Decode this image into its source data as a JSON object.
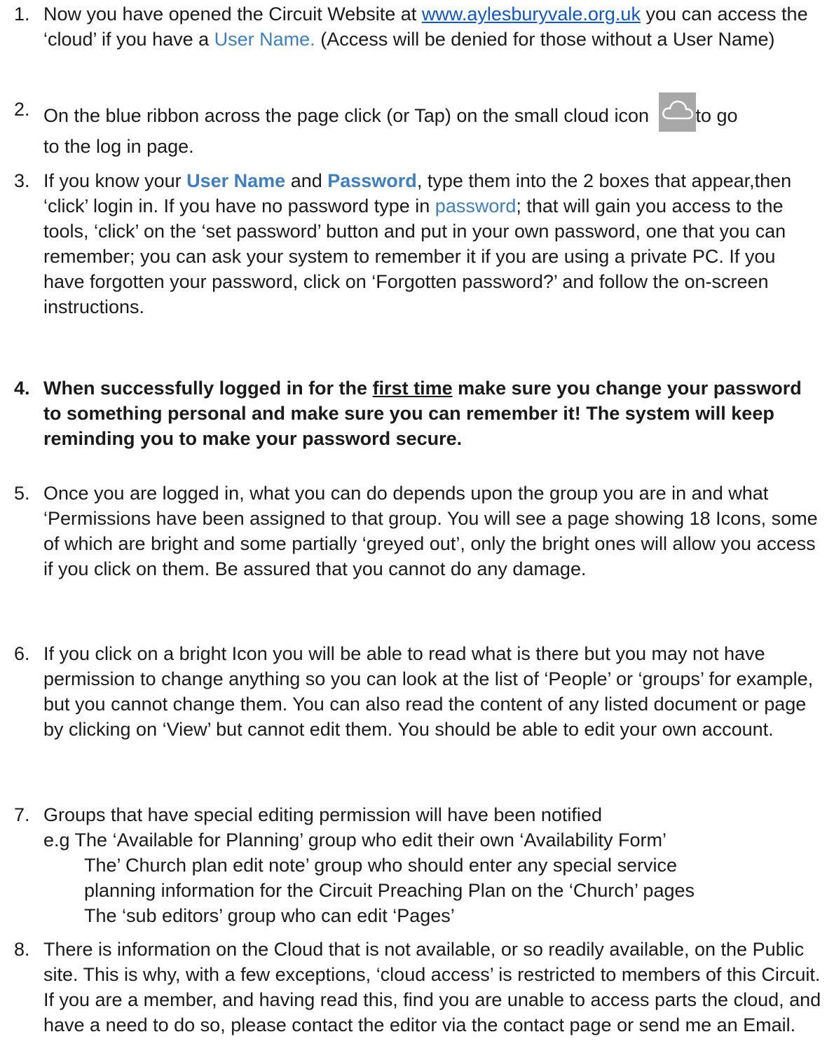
{
  "items": [
    {
      "number": "1.",
      "pre_link": "Now you have opened the Circuit Website at ",
      "link": "www.aylesburyvale.org.uk",
      "post_link": " you can access the ‘cloud’ if you have a ",
      "user_name": "User Name.",
      "tail": " (Access will be denied for those without a User Name)"
    },
    {
      "number": "2.",
      "line1": "On the blue ribbon across the page click (or Tap) on the small cloud icon",
      "line1_tail": "to go",
      "line2": "to the log in page.",
      "icon": "cloud-icon"
    },
    {
      "number": "3.",
      "pre": "If you know your ",
      "user_name": "User Name",
      "and": " and ",
      "password": "Password",
      "mid": ", type them into the 2 boxes that appear,then ‘click’ login in. If you have no password type in ",
      "password_word": "password",
      "tail": "; that will gain you access to the tools, ‘click’ on the ‘set password’ button and put in your own password, one that you can remember; you can ask your system to remember it if you are using a private PC. If you have forgotten your password, click on ‘Forgotten password?’ and follow the on-screen instructions."
    },
    {
      "number": "4.",
      "pre": "When successfully logged in for the ",
      "underlined": "first time",
      "tail": " make sure you change your password to something personal and make sure you can remember it! The system will keep reminding you to make your password secure."
    },
    {
      "number": "5.",
      "text": "Once you are logged in, what you can do depends upon the group you are in and what ‘Permissions have been assigned to that group. You will see a page showing 18 Icons, some of which are bright and some partially ‘greyed out’, only the bright ones will allow you access if you click on them. Be assured that you cannot do any damage."
    },
    {
      "number": "6.",
      "text": "If you click on a bright Icon you will be able to read what is there but you may not have permission to change anything so you can look at the list of ‘People’ or ‘groups’ for example, but you cannot change them. You can also read the content of any listed document or page by clicking on ‘View’ but cannot edit them. You should be able to edit your own account."
    },
    {
      "number": "7.",
      "line1": "Groups that have special editing permission will have been notified",
      "eg_line": "e.g  The ‘Available for Planning’ group who edit their own ‘Availability Form’",
      "line3": "The’ Church plan edit note’ group who should enter any special service",
      "line4": "planning information for the Circuit Preaching Plan on the ‘Church’ pages",
      "line5": "The ‘sub editors’ group who can edit ‘Pages’"
    },
    {
      "number": "8.",
      "text": "There is information on the Cloud that is not available, or so readily available, on the Public site. This is why, with a few exceptions, ‘cloud access’ is restricted to members of this Circuit. If you are a member, and having read this, find you are unable to access parts the cloud, and have a need to do so, please contact the editor via the contact page or send me an Email."
    }
  ]
}
